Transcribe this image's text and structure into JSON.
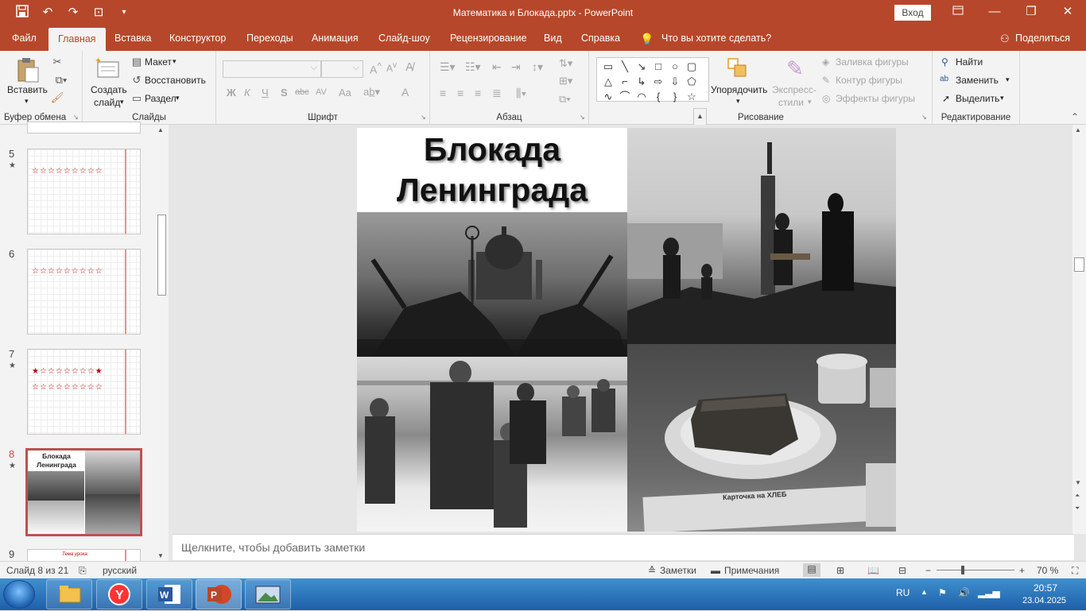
{
  "titlebar": {
    "title": "Математика и Блокада.pptx  -  PowerPoint",
    "signin": "Вход",
    "qat": {
      "save_icon": "save-icon",
      "undo_icon": "undo-icon",
      "redo_icon": "redo-icon",
      "present_icon": "present-from-start-icon",
      "customize_icon": "customize-qat-icon"
    }
  },
  "tabs": [
    "Файл",
    "Главная",
    "Вставка",
    "Конструктор",
    "Переходы",
    "Анимация",
    "Слайд-шоу",
    "Рецензирование",
    "Вид",
    "Справка"
  ],
  "tell_me": "Что вы хотите сделать?",
  "share": "Поделиться",
  "ribbon": {
    "clipboard": {
      "paste": "Вставить",
      "label": "Буфер обмена"
    },
    "slides": {
      "new_slide_1": "Создать",
      "new_slide_2": "слайд",
      "layout": "Макет",
      "reset": "Восстановить",
      "section": "Раздел",
      "label": "Слайды"
    },
    "font": {
      "bold": "Ж",
      "italic": "К",
      "underline": "Ч",
      "shadow": "S",
      "strike": "abc",
      "spacing": "AV",
      "case": "Aa",
      "color": "A",
      "label": "Шрифт"
    },
    "paragraph": {
      "label": "Абзац"
    },
    "drawing": {
      "arrange": "Упорядочить",
      "quick_1": "Экспресс-",
      "quick_2": "стили",
      "fill": "Заливка фигуры",
      "outline": "Контур фигуры",
      "effects": "Эффекты фигуры",
      "label": "Рисование"
    },
    "editing": {
      "find": "Найти",
      "replace": "Заменить",
      "select": "Выделить",
      "label": "Редактирование"
    }
  },
  "thumbnails": [
    {
      "num": "5",
      "star": "★"
    },
    {
      "num": "6",
      "star": ""
    },
    {
      "num": "7",
      "star": "★"
    },
    {
      "num": "8",
      "star": "★",
      "title_1": "Блокада",
      "title_2": "Ленинграда"
    },
    {
      "num": "9",
      "text": "Тема урока:"
    }
  ],
  "slide": {
    "title_line1": "Блокада",
    "title_line2": "Ленинграда",
    "ration_card_text": "Карточка на ХЛЕБ"
  },
  "notes_placeholder": "Щелкните, чтобы добавить заметки",
  "status": {
    "slide_info": "Слайд 8 из 21",
    "language": "русский",
    "notes": "Заметки",
    "comments": "Примечания",
    "zoom": "70 %",
    "zoom_value": 70
  },
  "taskbar": {
    "lang": "RU",
    "time": "20:57",
    "date": "23.04.2025"
  },
  "colors": {
    "accent": "#b7472a",
    "selected_thumb": "#c0504d"
  }
}
